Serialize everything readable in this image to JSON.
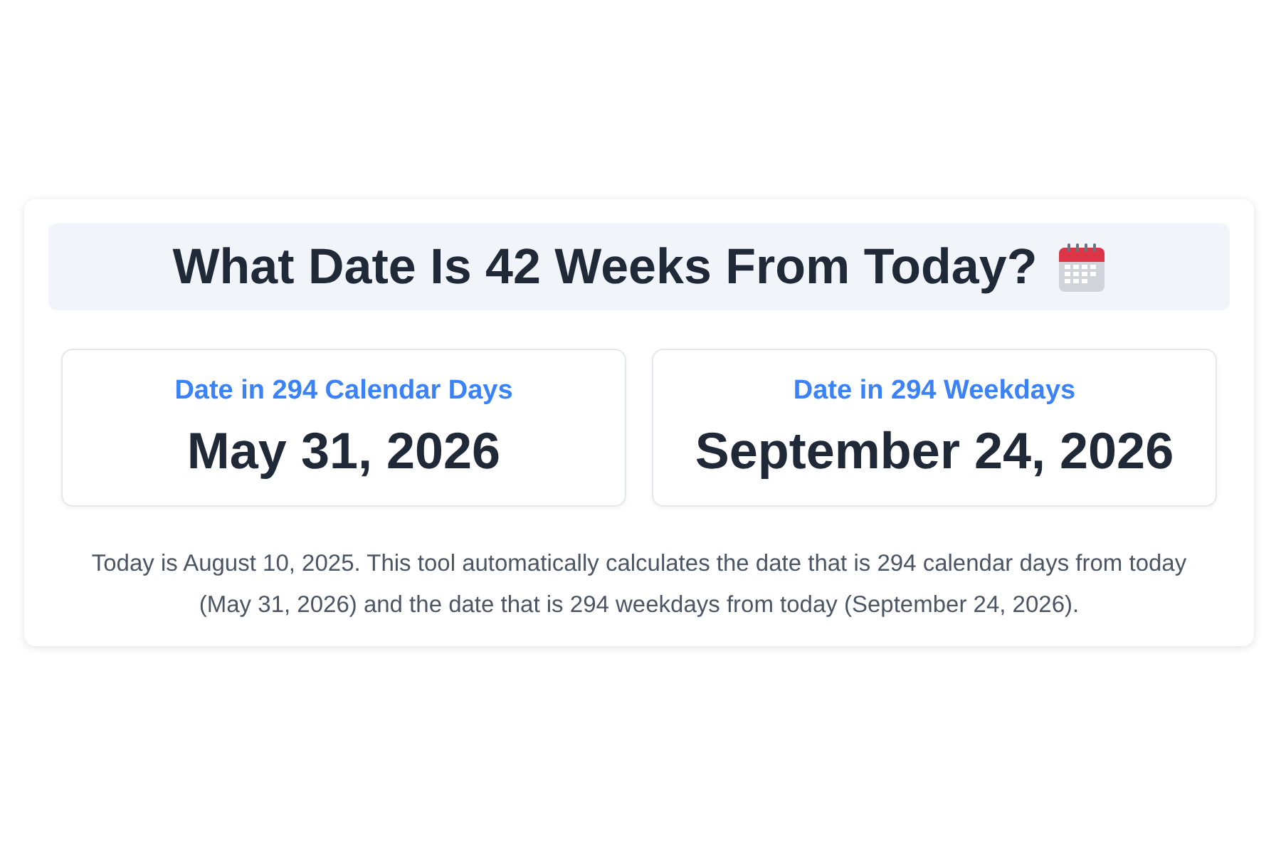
{
  "title": "What Date Is 42 Weeks From Today?",
  "results": [
    {
      "label": "Date in 294 Calendar Days",
      "date": "May 31, 2026"
    },
    {
      "label": "Date in 294 Weekdays",
      "date": "September 24, 2026"
    }
  ],
  "description": "Today is August 10, 2025. This tool automatically calculates the date that is 294 calendar days from today (May 31, 2026) and the date that is 294 weekdays from today (September 24, 2026)."
}
